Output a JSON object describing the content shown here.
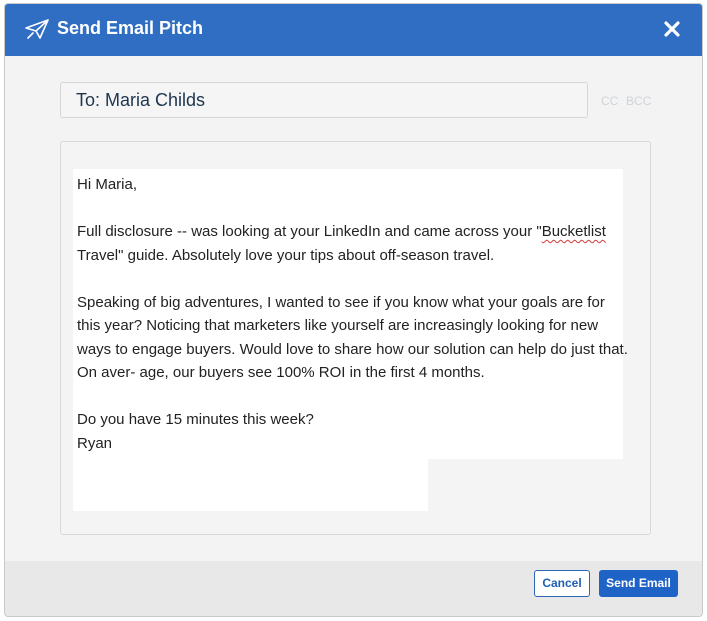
{
  "header": {
    "title": "Send Email Pitch",
    "icon": "paper-plane-icon",
    "close_icon": "close-icon",
    "bg_color": "#2f6ec2"
  },
  "recipient": {
    "to_text": "To: Maria Childs",
    "cc_label": "CC",
    "bcc_label": "BCC"
  },
  "email": {
    "greeting": "Hi Maria,",
    "p1_before": "Full disclosure -- was looking at your LinkedIn and came across your \"",
    "p1_misspelled": "Bucketlist",
    "p1_after": " Travel\" guide. Absolutely love your tips about off-season travel.",
    "p2": "Speaking of big adventures, I wanted to see if you know what your goals are for this year? Noticing that marketers like yourself are increasingly looking for new ways to engage buyers. Would love to share how our solution can help do just that. On aver- age, our buyers see 100% ROI in the first 4 months.",
    "question": "Do you have 15 minutes this week?",
    "signature": "Ryan"
  },
  "footer": {
    "cancel_label": "Cancel",
    "send_label": "Send Email"
  }
}
